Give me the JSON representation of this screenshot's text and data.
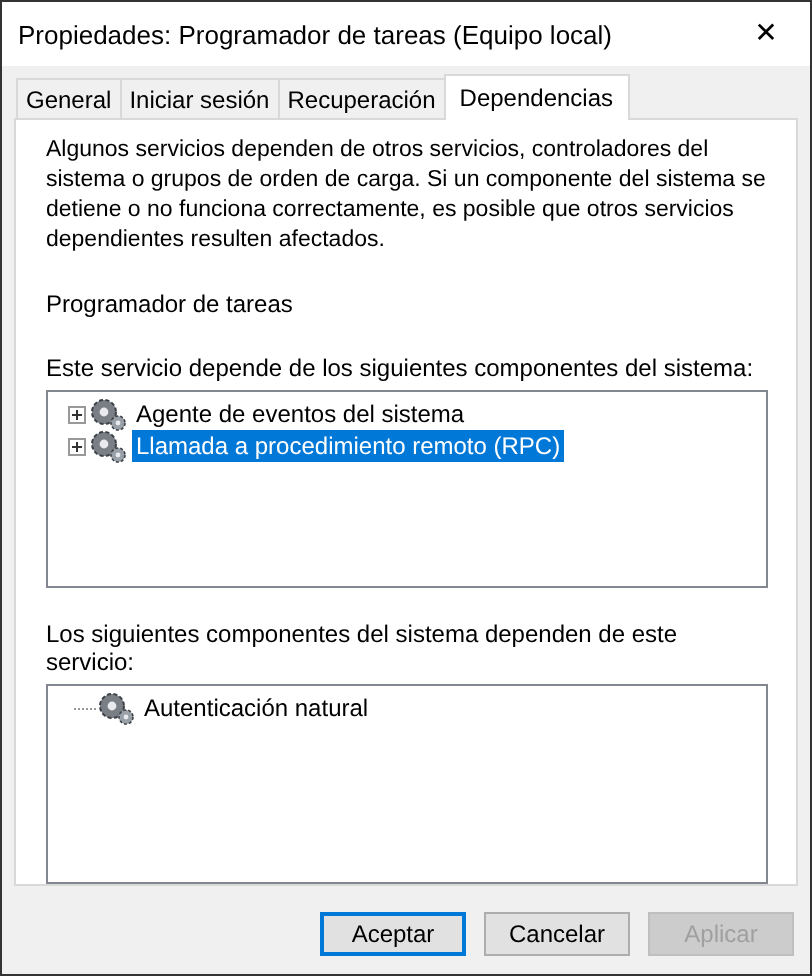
{
  "window": {
    "title": "Propiedades: Programador de tareas (Equipo local)",
    "close": "✕"
  },
  "tabs": [
    {
      "label": "General",
      "selected": false
    },
    {
      "label": "Iniciar sesión",
      "selected": false
    },
    {
      "label": "Recuperación",
      "selected": false
    },
    {
      "label": "Dependencias",
      "selected": true
    }
  ],
  "description": "Algunos servicios dependen de otros servicios, controladores del sistema o grupos de orden de carga. Si un componente del sistema se detiene o no funciona correctamente, es posible que otros servicios dependientes resulten afectados.",
  "service_name": "Programador de tareas",
  "depends_on": {
    "label": "Este servicio depende de los siguientes componentes del sistema:",
    "items": [
      {
        "name": "Agente de eventos del sistema",
        "expanded": false,
        "selected": false
      },
      {
        "name": "Llamada a procedimiento remoto (RPC)",
        "expanded": false,
        "selected": true
      }
    ]
  },
  "dependents": {
    "label": "Los siguientes componentes del sistema dependen de este servicio:",
    "items": [
      {
        "name": "Autenticación natural",
        "selected": false
      }
    ]
  },
  "buttons": [
    {
      "label": "Aceptar",
      "kind": "default",
      "disabled": false
    },
    {
      "label": "Cancelar",
      "kind": "normal",
      "disabled": false
    },
    {
      "label": "Aplicar",
      "kind": "normal",
      "disabled": true
    }
  ]
}
